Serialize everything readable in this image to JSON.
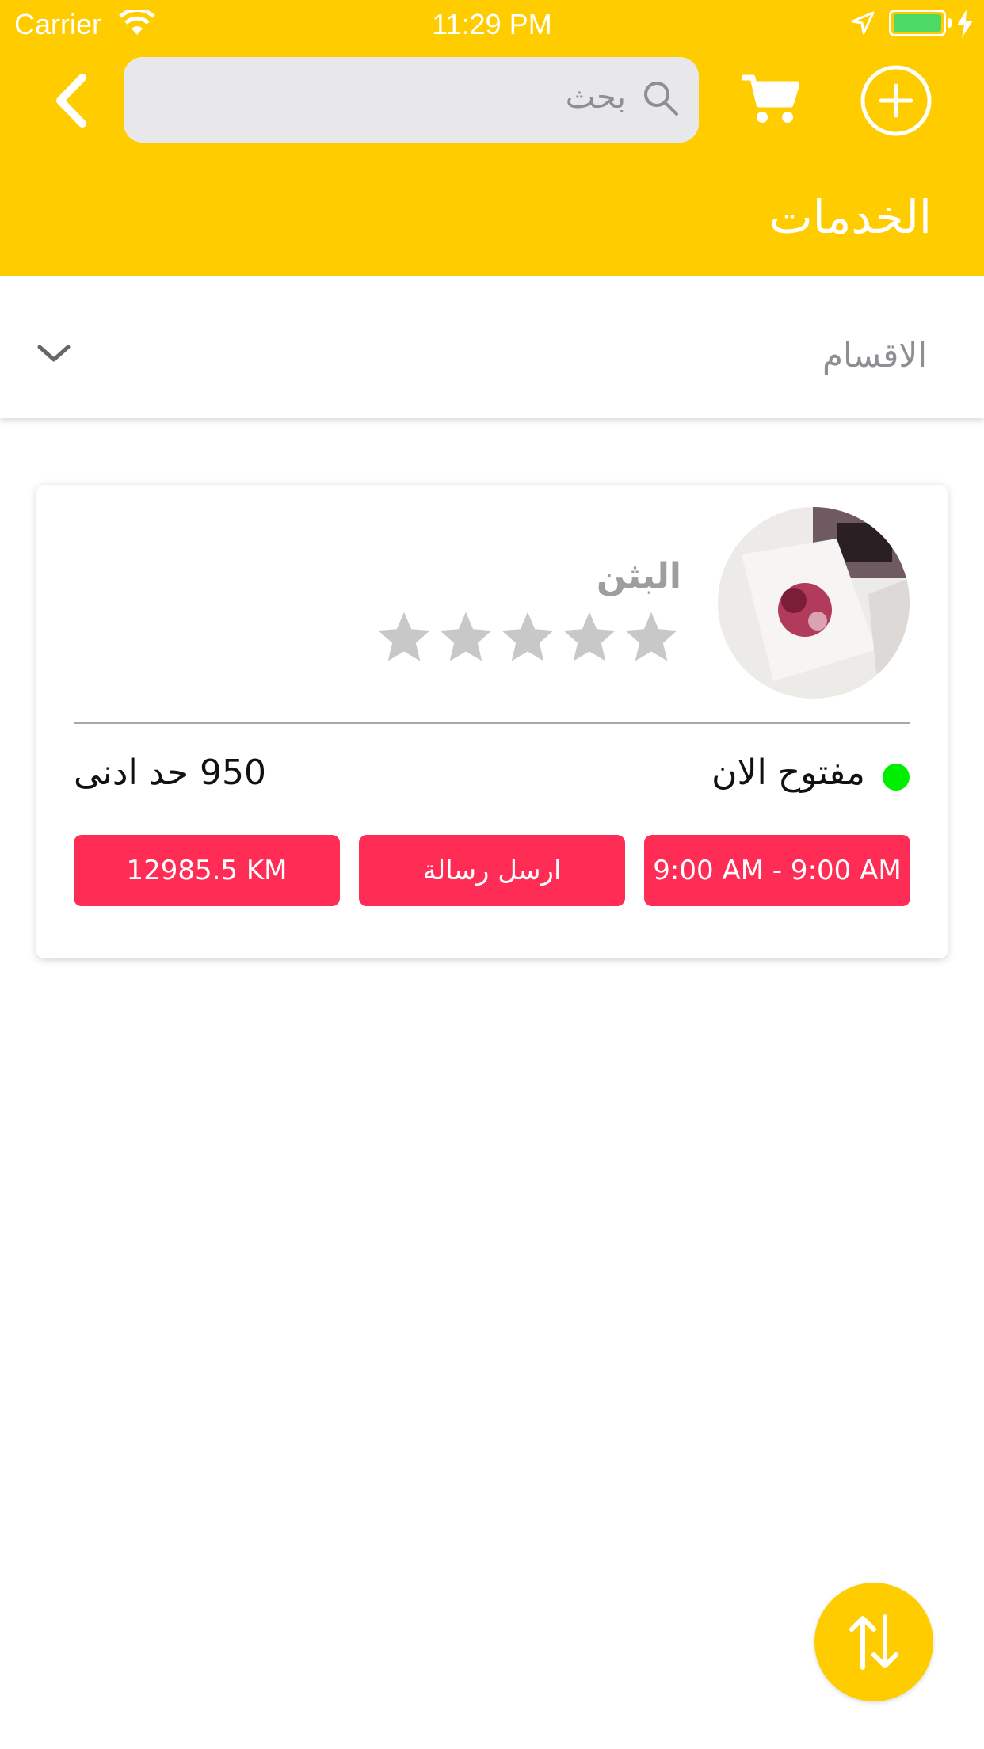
{
  "status_bar": {
    "carrier": "Carrier",
    "time": "11:29 PM"
  },
  "header": {
    "search_placeholder": "بحث",
    "title": "الخدمات"
  },
  "filter": {
    "label": "الاقسام"
  },
  "service_card": {
    "name": "البثن",
    "rating": 0,
    "rating_max": 5,
    "status": "مفتوح الان",
    "minimum": "950  حد ادنى",
    "hours_button": "9:00 AM - 9:00 AM",
    "message_button": "ارسل رسالة",
    "distance_button": "12985.5 KM"
  },
  "colors": {
    "accent": "#FFCC00",
    "button": "#FF2D55",
    "open_indicator": "#00EE00",
    "star_empty": "#C8C8C8"
  },
  "icons": {
    "back": "chevron-left-icon",
    "search": "search-icon",
    "cart": "cart-icon",
    "add": "plus-circle-icon",
    "dropdown": "chevron-down-icon",
    "sort": "sort-arrows-icon"
  }
}
